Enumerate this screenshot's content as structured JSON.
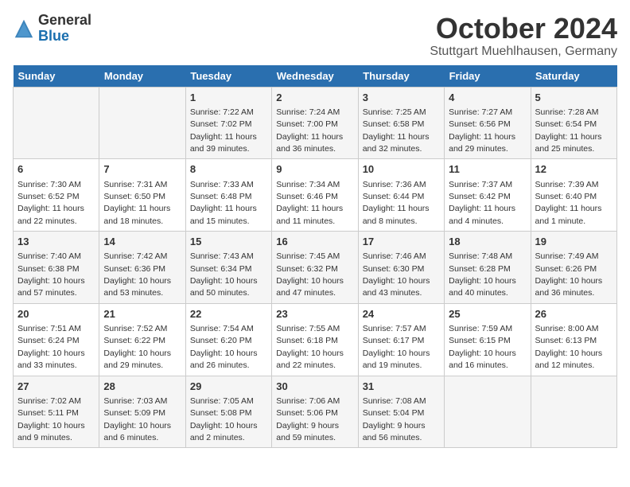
{
  "header": {
    "logo_general": "General",
    "logo_blue": "Blue",
    "month_title": "October 2024",
    "location": "Stuttgart Muehlhausen, Germany"
  },
  "weekdays": [
    "Sunday",
    "Monday",
    "Tuesday",
    "Wednesday",
    "Thursday",
    "Friday",
    "Saturday"
  ],
  "rows": [
    [
      {
        "day": "",
        "info": ""
      },
      {
        "day": "",
        "info": ""
      },
      {
        "day": "1",
        "info": "Sunrise: 7:22 AM\nSunset: 7:02 PM\nDaylight: 11 hours and 39 minutes."
      },
      {
        "day": "2",
        "info": "Sunrise: 7:24 AM\nSunset: 7:00 PM\nDaylight: 11 hours and 36 minutes."
      },
      {
        "day": "3",
        "info": "Sunrise: 7:25 AM\nSunset: 6:58 PM\nDaylight: 11 hours and 32 minutes."
      },
      {
        "day": "4",
        "info": "Sunrise: 7:27 AM\nSunset: 6:56 PM\nDaylight: 11 hours and 29 minutes."
      },
      {
        "day": "5",
        "info": "Sunrise: 7:28 AM\nSunset: 6:54 PM\nDaylight: 11 hours and 25 minutes."
      }
    ],
    [
      {
        "day": "6",
        "info": "Sunrise: 7:30 AM\nSunset: 6:52 PM\nDaylight: 11 hours and 22 minutes."
      },
      {
        "day": "7",
        "info": "Sunrise: 7:31 AM\nSunset: 6:50 PM\nDaylight: 11 hours and 18 minutes."
      },
      {
        "day": "8",
        "info": "Sunrise: 7:33 AM\nSunset: 6:48 PM\nDaylight: 11 hours and 15 minutes."
      },
      {
        "day": "9",
        "info": "Sunrise: 7:34 AM\nSunset: 6:46 PM\nDaylight: 11 hours and 11 minutes."
      },
      {
        "day": "10",
        "info": "Sunrise: 7:36 AM\nSunset: 6:44 PM\nDaylight: 11 hours and 8 minutes."
      },
      {
        "day": "11",
        "info": "Sunrise: 7:37 AM\nSunset: 6:42 PM\nDaylight: 11 hours and 4 minutes."
      },
      {
        "day": "12",
        "info": "Sunrise: 7:39 AM\nSunset: 6:40 PM\nDaylight: 11 hours and 1 minute."
      }
    ],
    [
      {
        "day": "13",
        "info": "Sunrise: 7:40 AM\nSunset: 6:38 PM\nDaylight: 10 hours and 57 minutes."
      },
      {
        "day": "14",
        "info": "Sunrise: 7:42 AM\nSunset: 6:36 PM\nDaylight: 10 hours and 53 minutes."
      },
      {
        "day": "15",
        "info": "Sunrise: 7:43 AM\nSunset: 6:34 PM\nDaylight: 10 hours and 50 minutes."
      },
      {
        "day": "16",
        "info": "Sunrise: 7:45 AM\nSunset: 6:32 PM\nDaylight: 10 hours and 47 minutes."
      },
      {
        "day": "17",
        "info": "Sunrise: 7:46 AM\nSunset: 6:30 PM\nDaylight: 10 hours and 43 minutes."
      },
      {
        "day": "18",
        "info": "Sunrise: 7:48 AM\nSunset: 6:28 PM\nDaylight: 10 hours and 40 minutes."
      },
      {
        "day": "19",
        "info": "Sunrise: 7:49 AM\nSunset: 6:26 PM\nDaylight: 10 hours and 36 minutes."
      }
    ],
    [
      {
        "day": "20",
        "info": "Sunrise: 7:51 AM\nSunset: 6:24 PM\nDaylight: 10 hours and 33 minutes."
      },
      {
        "day": "21",
        "info": "Sunrise: 7:52 AM\nSunset: 6:22 PM\nDaylight: 10 hours and 29 minutes."
      },
      {
        "day": "22",
        "info": "Sunrise: 7:54 AM\nSunset: 6:20 PM\nDaylight: 10 hours and 26 minutes."
      },
      {
        "day": "23",
        "info": "Sunrise: 7:55 AM\nSunset: 6:18 PM\nDaylight: 10 hours and 22 minutes."
      },
      {
        "day": "24",
        "info": "Sunrise: 7:57 AM\nSunset: 6:17 PM\nDaylight: 10 hours and 19 minutes."
      },
      {
        "day": "25",
        "info": "Sunrise: 7:59 AM\nSunset: 6:15 PM\nDaylight: 10 hours and 16 minutes."
      },
      {
        "day": "26",
        "info": "Sunrise: 8:00 AM\nSunset: 6:13 PM\nDaylight: 10 hours and 12 minutes."
      }
    ],
    [
      {
        "day": "27",
        "info": "Sunrise: 7:02 AM\nSunset: 5:11 PM\nDaylight: 10 hours and 9 minutes."
      },
      {
        "day": "28",
        "info": "Sunrise: 7:03 AM\nSunset: 5:09 PM\nDaylight: 10 hours and 6 minutes."
      },
      {
        "day": "29",
        "info": "Sunrise: 7:05 AM\nSunset: 5:08 PM\nDaylight: 10 hours and 2 minutes."
      },
      {
        "day": "30",
        "info": "Sunrise: 7:06 AM\nSunset: 5:06 PM\nDaylight: 9 hours and 59 minutes."
      },
      {
        "day": "31",
        "info": "Sunrise: 7:08 AM\nSunset: 5:04 PM\nDaylight: 9 hours and 56 minutes."
      },
      {
        "day": "",
        "info": ""
      },
      {
        "day": "",
        "info": ""
      }
    ]
  ]
}
